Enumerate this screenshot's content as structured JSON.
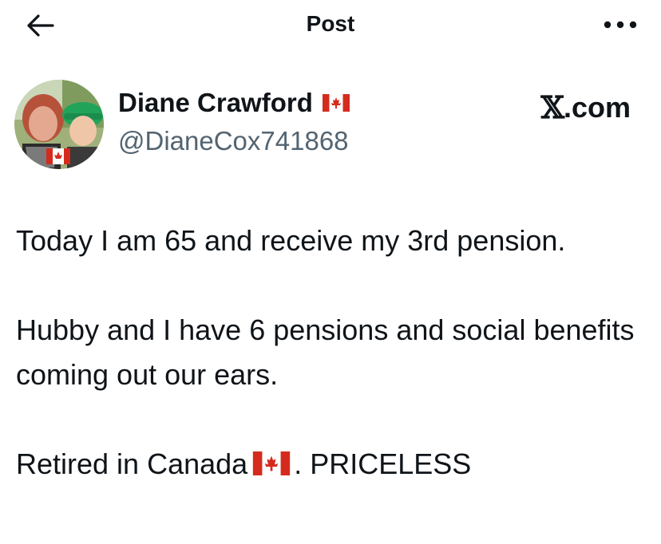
{
  "header": {
    "title": "Post",
    "back_icon": "arrow-left-icon",
    "more_icon": "more-horizontal-icon"
  },
  "author": {
    "name": "Diane Crawford",
    "name_flag": "canada-flag",
    "handle": "@DianeCox741868",
    "avatar": "avatar-photo"
  },
  "source": {
    "label": ".com",
    "mark": "𝕏"
  },
  "post": {
    "line1": "Today I am 65 and receive my 3rd pension.",
    "line2": "Hubby and I have 6 pensions and social benefits coming out our ears.",
    "line3_before": "Retired in Canada",
    "line3_flag": "canada-flag",
    "line3_after": ". PRICELESS"
  },
  "colors": {
    "text": "#0f1419",
    "secondary": "#536471",
    "flag_red": "#d52b1e"
  }
}
